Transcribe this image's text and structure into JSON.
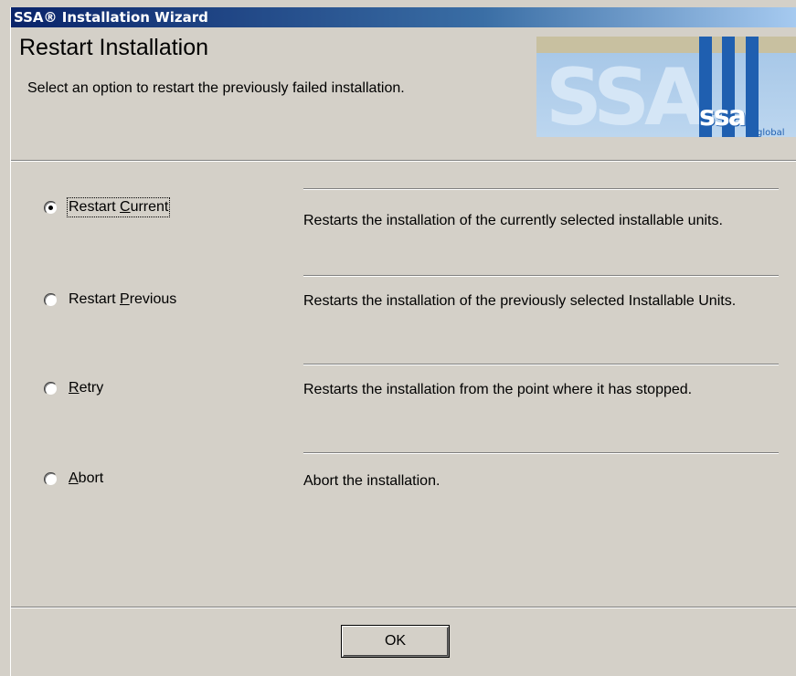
{
  "window": {
    "title": "SSA® Installation Wizard"
  },
  "header": {
    "title": "Restart Installation",
    "subtitle": "Select an option to restart  the previously failed installation."
  },
  "logo": {
    "mark": "ssa",
    "suffix": "global",
    "ghost": "SSA"
  },
  "options": [
    {
      "label_pre": "Restart ",
      "mnemonic": "C",
      "label_post": "urrent",
      "selected": true,
      "focused": true,
      "description": "Restarts the installation of  the currently selected installable units."
    },
    {
      "label_pre": "Restart ",
      "mnemonic": "P",
      "label_post": "revious",
      "selected": false,
      "focused": false,
      "description": "Restarts the installation of the previously selected Installable Units."
    },
    {
      "label_pre": "",
      "mnemonic": "R",
      "label_post": "etry",
      "selected": false,
      "focused": false,
      "description": "Restarts the installation from the point where it has stopped."
    },
    {
      "label_pre": "",
      "mnemonic": "A",
      "label_post": "bort",
      "selected": false,
      "focused": false,
      "description": "Abort the installation."
    }
  ],
  "buttons": {
    "ok_label": "OK"
  }
}
